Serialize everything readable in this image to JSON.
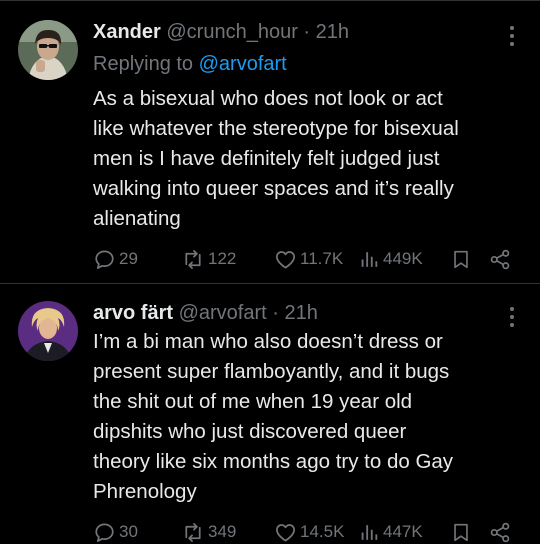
{
  "colors": {
    "background": "#000000",
    "text_primary": "#e7e9ea",
    "text_secondary": "#71767b",
    "link": "#1d9bf0",
    "divider": "#2f3336"
  },
  "tweets": [
    {
      "name": "Xander",
      "handle": "@crunch_hour",
      "dot": "·",
      "time": "21h",
      "reply_prefix": "Replying to ",
      "reply_mention": "@arvofart",
      "text": "As a bisexual who does not look or act\nlike whatever the stereotype for bisexual\nmen is I have definitely felt judged just\nwalking into queer spaces and it’s really\nalienating",
      "replies": "29",
      "retweets": "122",
      "likes": "11.7K",
      "views": "449K",
      "icons": [
        "reply-icon",
        "retweet-icon",
        "like-icon",
        "views-icon",
        "bookmark-icon",
        "share-icon",
        "more-icon"
      ]
    },
    {
      "name": "arvo färt",
      "handle": "@arvofart",
      "dot": "·",
      "time": "21h",
      "text": "I’m a bi man who also doesn’t dress or\npresent super flamboyantly, and it bugs\nthe shit out of me when 19 year old\ndipshits who just discovered queer\ntheory like six months ago try to do Gay\nPhrenology",
      "replies": "30",
      "retweets": "349",
      "likes": "14.5K",
      "views": "447K",
      "icons": [
        "reply-icon",
        "retweet-icon",
        "like-icon",
        "views-icon",
        "bookmark-icon",
        "share-icon",
        "more-icon"
      ]
    }
  ]
}
